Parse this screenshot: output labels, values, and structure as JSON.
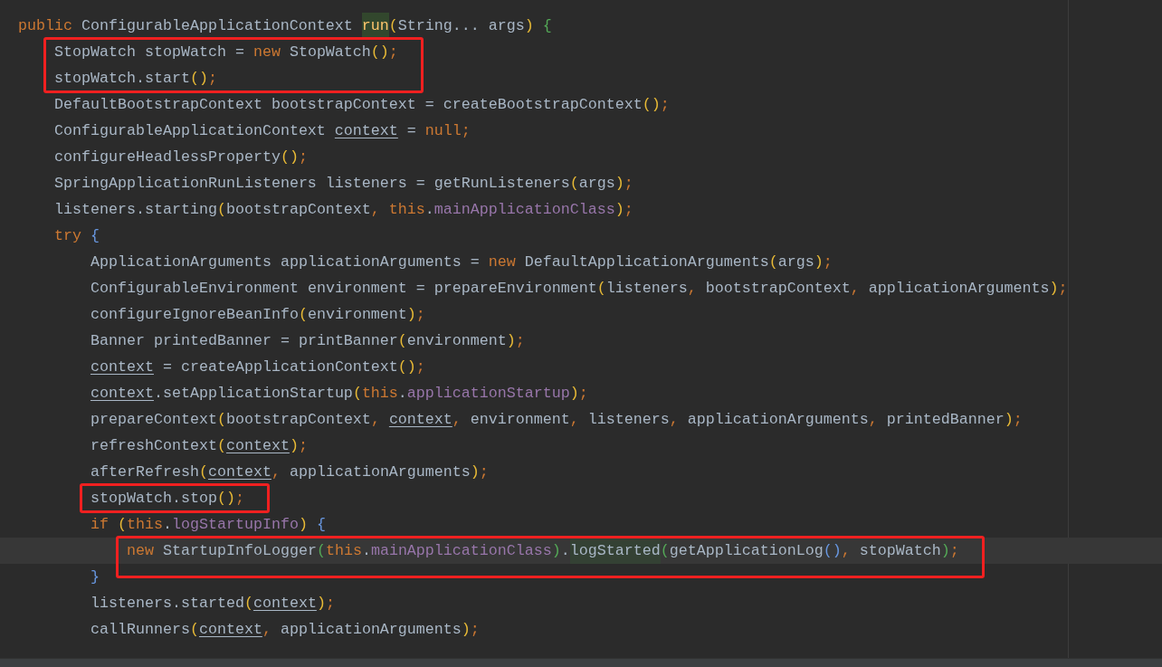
{
  "editor": {
    "lines": [
      {
        "boxed": false,
        "current": false,
        "tokens": [
          {
            "kind": "kw",
            "text": "public "
          },
          {
            "kind": "p",
            "text": "ConfigurableApplicationContext "
          },
          {
            "kind": "fn",
            "text": "run"
          },
          {
            "kind": "y",
            "text": "("
          },
          {
            "kind": "p",
            "text": "String... args"
          },
          {
            "kind": "y",
            "text": ")"
          },
          {
            "kind": "g",
            "text": " {"
          }
        ],
        "children": [
          {
            "boxed": true,
            "current": false,
            "tokens": [
              {
                "kind": "p",
                "text": "StopWatch stopWatch = "
              },
              {
                "kind": "kw",
                "text": "new "
              },
              {
                "kind": "p",
                "text": "StopWatch"
              },
              {
                "kind": "y",
                "text": "()"
              },
              {
                "kind": "op",
                "text": ";"
              }
            ]
          },
          {
            "boxed": true,
            "current": false,
            "tokens": [
              {
                "kind": "p",
                "text": "stopWatch.start"
              },
              {
                "kind": "y",
                "text": "()"
              },
              {
                "kind": "op",
                "text": ";"
              }
            ]
          },
          {
            "boxed": false,
            "current": false,
            "tokens": [
              {
                "kind": "p",
                "text": "DefaultBootstrapContext bootstrapContext = createBootstrapContext"
              },
              {
                "kind": "y",
                "text": "()"
              },
              {
                "kind": "op",
                "text": ";"
              }
            ]
          },
          {
            "boxed": false,
            "current": false,
            "tokens": [
              {
                "kind": "p",
                "text": "ConfigurableApplicationContext "
              },
              {
                "kind": "u",
                "text": "context"
              },
              {
                "kind": "p",
                "text": " = "
              },
              {
                "kind": "kw",
                "text": "null"
              },
              {
                "kind": "op",
                "text": ";"
              }
            ]
          },
          {
            "boxed": false,
            "current": false,
            "tokens": [
              {
                "kind": "p",
                "text": "configureHeadlessProperty"
              },
              {
                "kind": "y",
                "text": "()"
              },
              {
                "kind": "op",
                "text": ";"
              }
            ]
          },
          {
            "boxed": false,
            "current": false,
            "tokens": [
              {
                "kind": "p",
                "text": "SpringApplicationRunListeners listeners = getRunListeners"
              },
              {
                "kind": "y",
                "text": "("
              },
              {
                "kind": "p",
                "text": "args"
              },
              {
                "kind": "y",
                "text": ")"
              },
              {
                "kind": "op",
                "text": ";"
              }
            ]
          },
          {
            "boxed": false,
            "current": false,
            "tokens": [
              {
                "kind": "p",
                "text": "listeners.starting"
              },
              {
                "kind": "y",
                "text": "("
              },
              {
                "kind": "p",
                "text": "bootstrapContext"
              },
              {
                "kind": "op",
                "text": ", "
              },
              {
                "kind": "kw",
                "text": "this"
              },
              {
                "kind": "p",
                "text": "."
              },
              {
                "kind": "fld",
                "text": "mainApplicationClass"
              },
              {
                "kind": "y",
                "text": ")"
              },
              {
                "kind": "op",
                "text": ";"
              }
            ]
          },
          {
            "boxed": false,
            "current": false,
            "tokens": [
              {
                "kind": "kw",
                "text": "try"
              },
              {
                "kind": "b",
                "text": " {"
              }
            ],
            "children": [
              {
                "boxed": false,
                "current": false,
                "tokens": [
                  {
                    "kind": "p",
                    "text": "ApplicationArguments applicationArguments = "
                  },
                  {
                    "kind": "kw",
                    "text": "new "
                  },
                  {
                    "kind": "p",
                    "text": "DefaultApplicationArguments"
                  },
                  {
                    "kind": "y",
                    "text": "("
                  },
                  {
                    "kind": "p",
                    "text": "args"
                  },
                  {
                    "kind": "y",
                    "text": ")"
                  },
                  {
                    "kind": "op",
                    "text": ";"
                  }
                ]
              },
              {
                "boxed": false,
                "current": false,
                "tokens": [
                  {
                    "kind": "p",
                    "text": "ConfigurableEnvironment environment = prepareEnvironment"
                  },
                  {
                    "kind": "y",
                    "text": "("
                  },
                  {
                    "kind": "p",
                    "text": "listeners"
                  },
                  {
                    "kind": "op",
                    "text": ", "
                  },
                  {
                    "kind": "p",
                    "text": "bootstrapContext"
                  },
                  {
                    "kind": "op",
                    "text": ", "
                  },
                  {
                    "kind": "p",
                    "text": "applicationArguments"
                  },
                  {
                    "kind": "y",
                    "text": ")"
                  },
                  {
                    "kind": "op",
                    "text": ";"
                  }
                ]
              },
              {
                "boxed": false,
                "current": false,
                "tokens": [
                  {
                    "kind": "p",
                    "text": "configureIgnoreBeanInfo"
                  },
                  {
                    "kind": "y",
                    "text": "("
                  },
                  {
                    "kind": "p",
                    "text": "environment"
                  },
                  {
                    "kind": "y",
                    "text": ")"
                  },
                  {
                    "kind": "op",
                    "text": ";"
                  }
                ]
              },
              {
                "boxed": false,
                "current": false,
                "tokens": [
                  {
                    "kind": "p",
                    "text": "Banner printedBanner = printBanner"
                  },
                  {
                    "kind": "y",
                    "text": "("
                  },
                  {
                    "kind": "p",
                    "text": "environment"
                  },
                  {
                    "kind": "y",
                    "text": ")"
                  },
                  {
                    "kind": "op",
                    "text": ";"
                  }
                ]
              },
              {
                "boxed": false,
                "current": false,
                "tokens": [
                  {
                    "kind": "u",
                    "text": "context"
                  },
                  {
                    "kind": "p",
                    "text": " = createApplicationContext"
                  },
                  {
                    "kind": "y",
                    "text": "()"
                  },
                  {
                    "kind": "op",
                    "text": ";"
                  }
                ]
              },
              {
                "boxed": false,
                "current": false,
                "tokens": [
                  {
                    "kind": "u",
                    "text": "context"
                  },
                  {
                    "kind": "p",
                    "text": ".setApplicationStartup"
                  },
                  {
                    "kind": "y",
                    "text": "("
                  },
                  {
                    "kind": "kw",
                    "text": "this"
                  },
                  {
                    "kind": "p",
                    "text": "."
                  },
                  {
                    "kind": "fld",
                    "text": "applicationStartup"
                  },
                  {
                    "kind": "y",
                    "text": ")"
                  },
                  {
                    "kind": "op",
                    "text": ";"
                  }
                ]
              },
              {
                "boxed": false,
                "current": false,
                "tokens": [
                  {
                    "kind": "p",
                    "text": "prepareContext"
                  },
                  {
                    "kind": "y",
                    "text": "("
                  },
                  {
                    "kind": "p",
                    "text": "bootstrapContext"
                  },
                  {
                    "kind": "op",
                    "text": ", "
                  },
                  {
                    "kind": "u",
                    "text": "context"
                  },
                  {
                    "kind": "op",
                    "text": ", "
                  },
                  {
                    "kind": "p",
                    "text": "environment"
                  },
                  {
                    "kind": "op",
                    "text": ", "
                  },
                  {
                    "kind": "p",
                    "text": "listeners"
                  },
                  {
                    "kind": "op",
                    "text": ", "
                  },
                  {
                    "kind": "p",
                    "text": "applicationArguments"
                  },
                  {
                    "kind": "op",
                    "text": ", "
                  },
                  {
                    "kind": "p",
                    "text": "printedBanner"
                  },
                  {
                    "kind": "y",
                    "text": ")"
                  },
                  {
                    "kind": "op",
                    "text": ";"
                  }
                ]
              },
              {
                "boxed": false,
                "current": false,
                "tokens": [
                  {
                    "kind": "p",
                    "text": "refreshContext"
                  },
                  {
                    "kind": "y",
                    "text": "("
                  },
                  {
                    "kind": "u",
                    "text": "context"
                  },
                  {
                    "kind": "y",
                    "text": ")"
                  },
                  {
                    "kind": "op",
                    "text": ";"
                  }
                ]
              },
              {
                "boxed": false,
                "current": false,
                "tokens": [
                  {
                    "kind": "p",
                    "text": "afterRefresh"
                  },
                  {
                    "kind": "y",
                    "text": "("
                  },
                  {
                    "kind": "u",
                    "text": "context"
                  },
                  {
                    "kind": "op",
                    "text": ", "
                  },
                  {
                    "kind": "p",
                    "text": "applicationArguments"
                  },
                  {
                    "kind": "y",
                    "text": ")"
                  },
                  {
                    "kind": "op",
                    "text": ";"
                  }
                ]
              },
              {
                "boxed": true,
                "current": false,
                "tokens": [
                  {
                    "kind": "p",
                    "text": "stopWatch.stop"
                  },
                  {
                    "kind": "y",
                    "text": "()"
                  },
                  {
                    "kind": "op",
                    "text": ";"
                  }
                ]
              },
              {
                "boxed": false,
                "current": false,
                "tokens": [
                  {
                    "kind": "kw",
                    "text": "if "
                  },
                  {
                    "kind": "y",
                    "text": "("
                  },
                  {
                    "kind": "kw",
                    "text": "this"
                  },
                  {
                    "kind": "p",
                    "text": "."
                  },
                  {
                    "kind": "fld",
                    "text": "logStartupInfo"
                  },
                  {
                    "kind": "y",
                    "text": ")"
                  },
                  {
                    "kind": "b",
                    "text": " {"
                  }
                ],
                "children": [
                  {
                    "boxed": true,
                    "current": true,
                    "tokens": [
                      {
                        "kind": "kw",
                        "text": "new "
                      },
                      {
                        "kind": "p",
                        "text": "StartupInfoLogger"
                      },
                      {
                        "kind": "g",
                        "text": "("
                      },
                      {
                        "kind": "kw",
                        "text": "this"
                      },
                      {
                        "kind": "p",
                        "text": "."
                      },
                      {
                        "kind": "fld",
                        "text": "mainApplicationClass"
                      },
                      {
                        "kind": "g",
                        "text": ")"
                      },
                      {
                        "kind": "p",
                        "text": "."
                      },
                      {
                        "kind": "hl",
                        "text": "logStarted"
                      },
                      {
                        "kind": "g",
                        "text": "("
                      },
                      {
                        "kind": "p",
                        "text": "getApplicationLog"
                      },
                      {
                        "kind": "b",
                        "text": "()"
                      },
                      {
                        "kind": "op",
                        "text": ", "
                      },
                      {
                        "kind": "p",
                        "text": "stopWatch"
                      },
                      {
                        "kind": "g",
                        "text": ")"
                      },
                      {
                        "kind": "op",
                        "text": ";"
                      }
                    ]
                  }
                ]
              },
              {
                "boxed": false,
                "current": false,
                "tokens": [
                  {
                    "kind": "b",
                    "text": "}"
                  }
                ]
              },
              {
                "boxed": false,
                "current": false,
                "tokens": [
                  {
                    "kind": "p",
                    "text": "listeners.started"
                  },
                  {
                    "kind": "y",
                    "text": "("
                  },
                  {
                    "kind": "u",
                    "text": "context"
                  },
                  {
                    "kind": "y",
                    "text": ")"
                  },
                  {
                    "kind": "op",
                    "text": ";"
                  }
                ]
              },
              {
                "boxed": false,
                "current": false,
                "tokens": [
                  {
                    "kind": "p",
                    "text": "callRunners"
                  },
                  {
                    "kind": "y",
                    "text": "("
                  },
                  {
                    "kind": "u",
                    "text": "context"
                  },
                  {
                    "kind": "op",
                    "text": ", "
                  },
                  {
                    "kind": "p",
                    "text": "applicationArguments"
                  },
                  {
                    "kind": "y",
                    "text": ")"
                  },
                  {
                    "kind": "op",
                    "text": ";"
                  }
                ]
              }
            ]
          }
        ]
      }
    ]
  }
}
